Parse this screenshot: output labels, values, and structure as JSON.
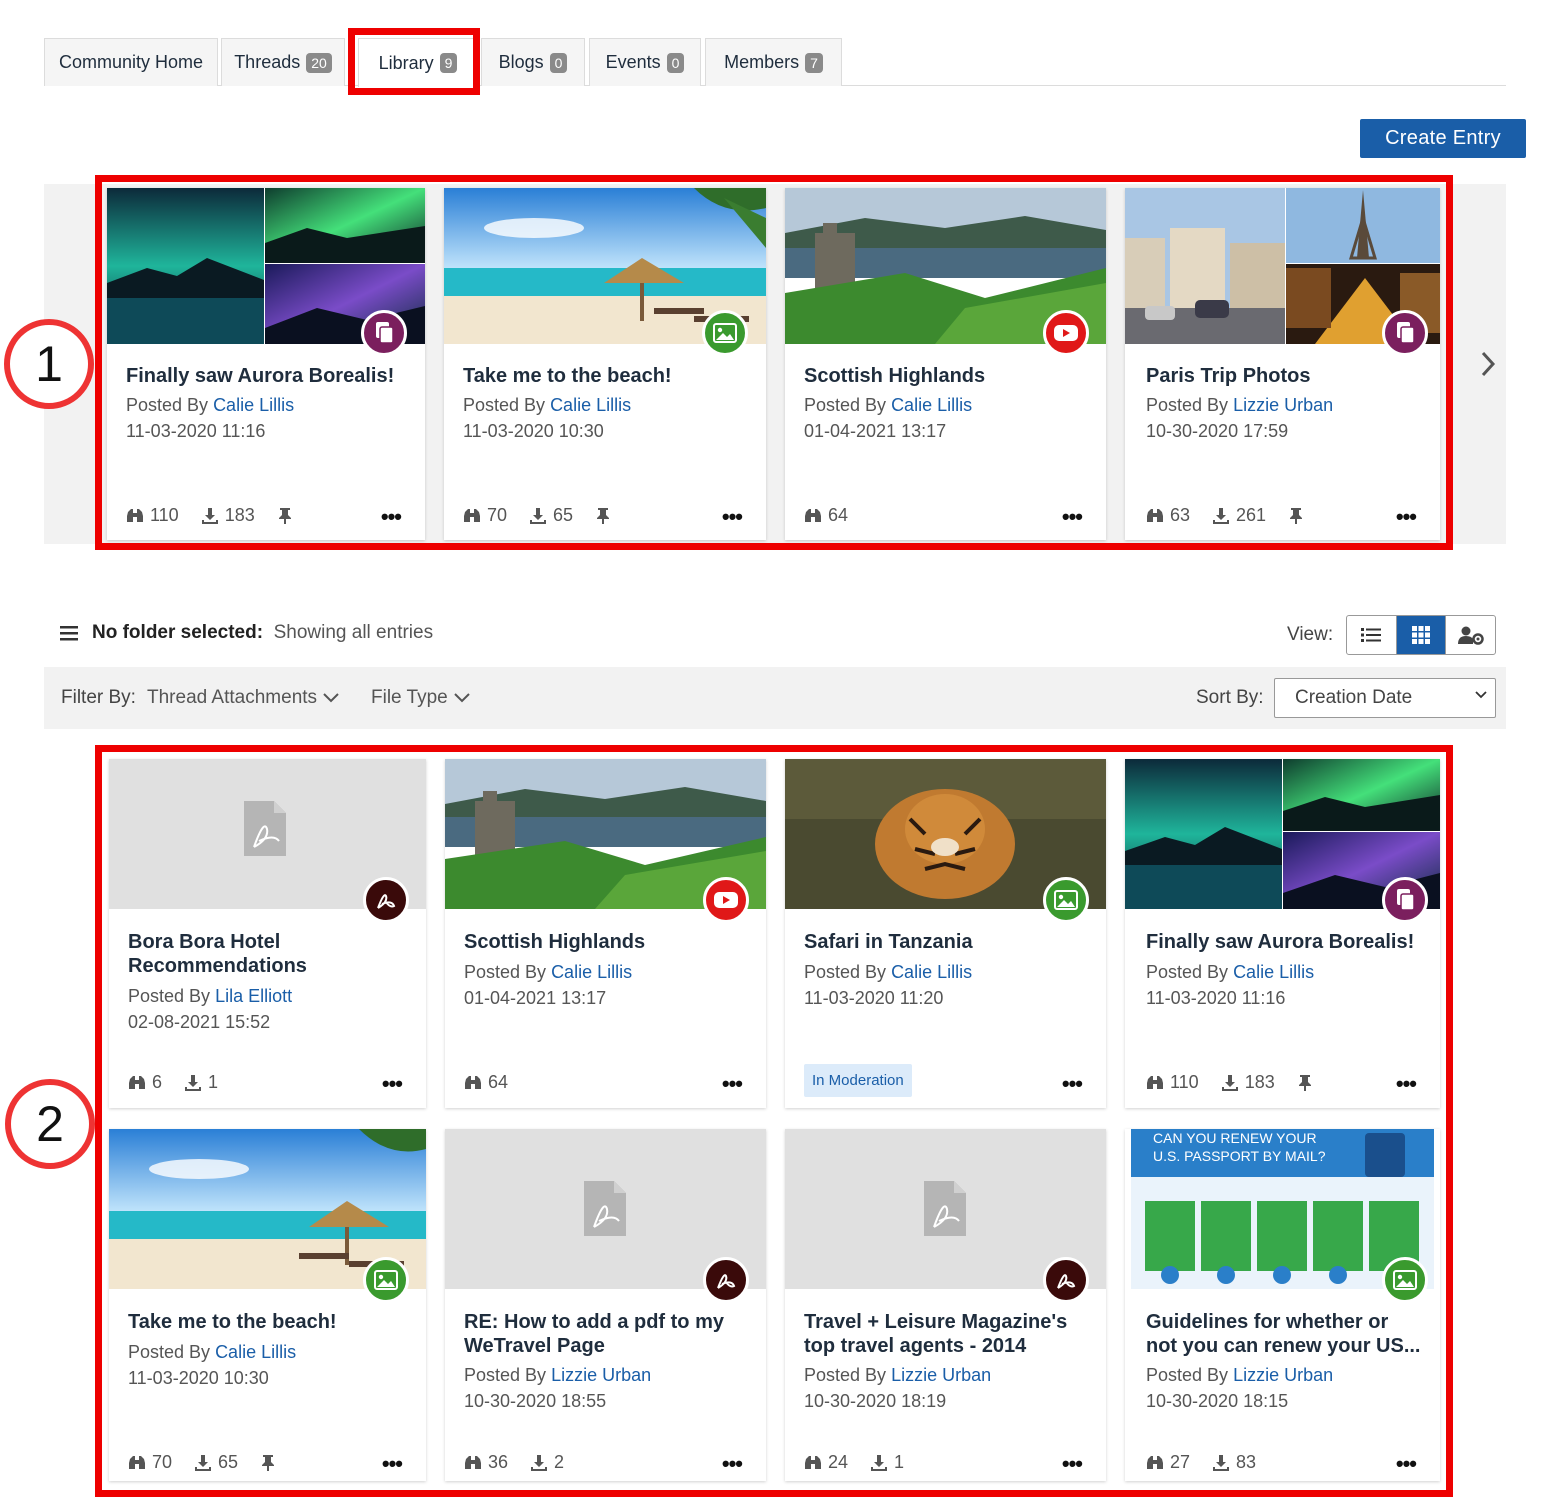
{
  "tabs": [
    {
      "label": "Community Home",
      "count": ""
    },
    {
      "label": "Threads",
      "count": "20"
    },
    {
      "label": "Library",
      "count": "9"
    },
    {
      "label": "Blogs",
      "count": "0"
    },
    {
      "label": "Events",
      "count": "0"
    },
    {
      "label": "Members",
      "count": "7"
    }
  ],
  "create_entry_label": "Create Entry",
  "featured": [
    {
      "title": "Finally saw Aurora Borealis!",
      "posted_by": "Posted By",
      "author": "Calie Lillis",
      "date": "11-03-2020 11:16",
      "views": "110",
      "downloads": "183",
      "pinned": true,
      "type": "document-icon"
    },
    {
      "title": "Take me to the beach!",
      "posted_by": "Posted By",
      "author": "Calie Lillis",
      "date": "11-03-2020 10:30",
      "views": "70",
      "downloads": "65",
      "pinned": true,
      "type": "image-icon"
    },
    {
      "title": "Scottish Highlands",
      "posted_by": "Posted By",
      "author": "Calie Lillis",
      "date": "01-04-2021 13:17",
      "views": "64",
      "downloads": "",
      "pinned": false,
      "type": "youtube-icon"
    },
    {
      "title": "Paris Trip Photos",
      "posted_by": "Posted By",
      "author": "Lizzie Urban",
      "date": "10-30-2020 17:59",
      "views": "63",
      "downloads": "261",
      "pinned": true,
      "type": "document-icon"
    }
  ],
  "toolbar": {
    "folder_bold": "No folder selected:",
    "folder_sub": "Showing all entries",
    "view_label": "View:",
    "filter_label": "Filter By:",
    "filter_attachments": "Thread Attachments",
    "filter_filetype": "File Type",
    "sort_label": "Sort By:",
    "sort_value": "Creation Date"
  },
  "entries": [
    {
      "title": "Bora Bora Hotel Recommendations",
      "posted_by": "Posted By",
      "author": "Lila Elliott",
      "date": "02-08-2021 15:52",
      "views": "6",
      "downloads": "1",
      "type": "pdf-icon"
    },
    {
      "title": "Scottish Highlands",
      "posted_by": "Posted By",
      "author": "Calie Lillis",
      "date": "01-04-2021 13:17",
      "views": "64",
      "downloads": "",
      "type": "youtube-icon"
    },
    {
      "title": "Safari in Tanzania",
      "posted_by": "Posted By",
      "author": "Calie Lillis",
      "date": "11-03-2020 11:20",
      "views": "",
      "downloads": "",
      "moderation": "In Moderation",
      "type": "image-icon"
    },
    {
      "title": "Finally saw Aurora Borealis!",
      "posted_by": "Posted By",
      "author": "Calie Lillis",
      "date": "11-03-2020 11:16",
      "views": "110",
      "downloads": "183",
      "pinned": true,
      "type": "document-icon"
    },
    {
      "title": "Take me to the beach!",
      "posted_by": "Posted By",
      "author": "Calie Lillis",
      "date": "11-03-2020 10:30",
      "views": "70",
      "downloads": "65",
      "pinned": true,
      "type": "image-icon"
    },
    {
      "title": "RE: How to add a pdf to my WeTravel Page",
      "posted_by": "Posted By",
      "author": "Lizzie Urban",
      "date": "10-30-2020 18:55",
      "views": "36",
      "downloads": "2",
      "type": "pdf-icon"
    },
    {
      "title": "Travel + Leisure Magazine's top travel agents - 2014",
      "posted_by": "Posted By",
      "author": "Lizzie Urban",
      "date": "10-30-2020 18:19",
      "views": "24",
      "downloads": "1",
      "type": "pdf-icon"
    },
    {
      "title": "Guidelines for whether or not you can renew your US...",
      "posted_by": "Posted By",
      "author": "Lizzie Urban",
      "date": "10-30-2020 18:15",
      "views": "27",
      "downloads": "83",
      "type": "image-icon"
    }
  ],
  "passport_image_text": {
    "line1": "CAN YOU RENEW YOUR",
    "line2": "U.S. PASSPORT BY MAIL?"
  },
  "annotations": [
    "1",
    "2"
  ],
  "more_label": "•••"
}
